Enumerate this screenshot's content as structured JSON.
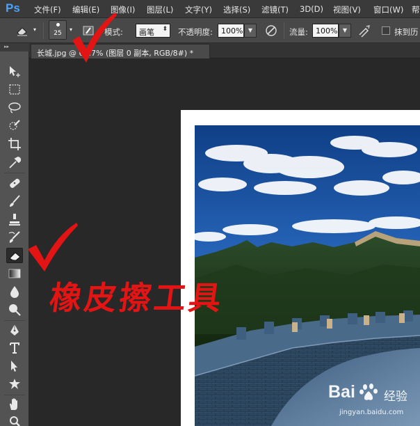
{
  "app": {
    "logo": "Ps",
    "menu": [
      "文件(F)",
      "编辑(E)",
      "图像(I)",
      "图层(L)",
      "文字(Y)",
      "选择(S)",
      "滤镜(T)",
      "3D(D)",
      "视图(V)",
      "窗口(W)",
      "帮"
    ]
  },
  "options_bar": {
    "brush_size": "25",
    "mode_label": "模式:",
    "mode_value": "画笔",
    "opacity_label": "不透明度:",
    "opacity_value": "100%",
    "flow_label": "流量:",
    "flow_value": "100%",
    "erase_history_label": "抹到历"
  },
  "document": {
    "tab_title": "长城.jpg @ 66.7% (图层 0 副本, RGB/8#) *"
  },
  "annotation": {
    "text": "橡皮擦工具",
    "color": "#e31414"
  },
  "watermark": {
    "logo": "Bai",
    "suffix": "经验",
    "url": "jingyan.baidu.com"
  },
  "tools": [
    "move-icon",
    "marquee-icon",
    "lasso-icon",
    "quick-select-icon",
    "crop-icon",
    "eyedropper-icon",
    "healing-brush-icon",
    "brush-icon",
    "clone-stamp-icon",
    "history-brush-icon",
    "eraser-icon",
    "gradient-icon",
    "blur-icon",
    "dodge-icon",
    "pen-icon",
    "type-icon",
    "path-select-icon",
    "shape-icon",
    "hand-icon",
    "zoom-icon"
  ],
  "colors": {
    "accent": "#4aa3ff",
    "panel": "#535353",
    "canvas": "#282828"
  }
}
